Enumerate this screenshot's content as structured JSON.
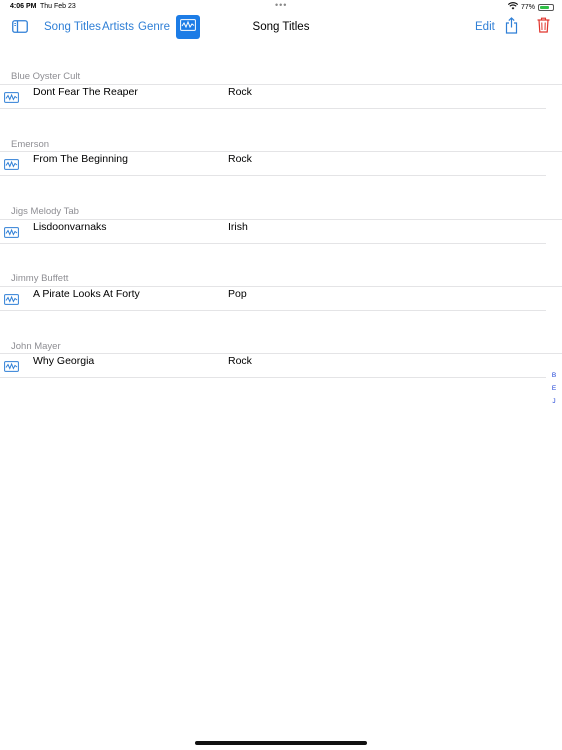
{
  "status_bar": {
    "time": "4:06 PM",
    "date": "Thu Feb 23",
    "battery": "77%",
    "battery_level": 0.77,
    "more_dots": "•••"
  },
  "nav": {
    "sidebar_icon": "sidebar-toggle-icon",
    "tabs": [
      "Song Titles",
      "Artists",
      "Genre"
    ],
    "waveform_icon": "waveform-icon",
    "title": "Song Titles",
    "edit": "Edit",
    "share_icon": "share-icon",
    "trash_icon": "trash-icon"
  },
  "colors": {
    "accent": "#2f7fd6",
    "active_button": "#1c7ce6",
    "delete": "#e0342c",
    "section_header": "#8e8e93",
    "index": "#1a3fd6"
  },
  "sections": [
    {
      "header": "Blue Oyster Cult",
      "title": "Dont Fear The Reaper",
      "genre": "Rock"
    },
    {
      "header": "Emerson",
      "title": "From The Beginning",
      "genre": "Rock"
    },
    {
      "header": "Jigs Melody Tab",
      "title": "Lisdoonvarnaks",
      "genre": "Irish"
    },
    {
      "header": "Jimmy Buffett",
      "title": "A Pirate Looks At Forty",
      "genre": "Pop"
    },
    {
      "header": "John Mayer",
      "title": "Why Georgia",
      "genre": "Rock"
    }
  ],
  "index": [
    "B",
    "E",
    "J"
  ]
}
